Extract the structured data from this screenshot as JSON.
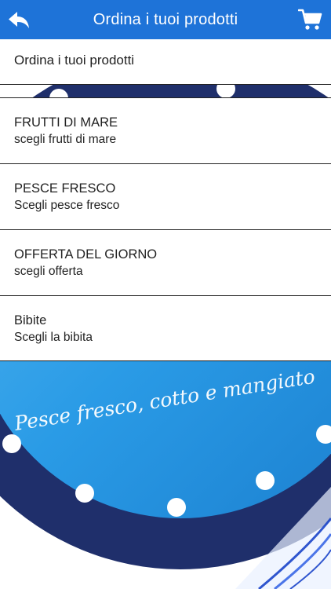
{
  "header": {
    "title": "Ordina i tuoi prodotti"
  },
  "list": {
    "section_title": "Ordina i tuoi prodotti",
    "items": [
      {
        "title": "FRUTTI DI MARE",
        "subtitle": "scegli frutti di mare"
      },
      {
        "title": "PESCE FRESCO",
        "subtitle": "Scegli pesce fresco"
      },
      {
        "title": "OFFERTA DEL GIORNO",
        "subtitle": "scegli offerta"
      },
      {
        "title": "Bibite",
        "subtitle": "Scegli la bibita"
      }
    ]
  },
  "logo": {
    "tagline": "Pesce fresco, cotto e mangiato"
  },
  "colors": {
    "header": "#1e73d8",
    "ring": "#1f2f6b",
    "sky": "#2a9be6"
  },
  "icons": {
    "back": "back-arrow-icon",
    "cart": "shopping-cart-icon"
  }
}
